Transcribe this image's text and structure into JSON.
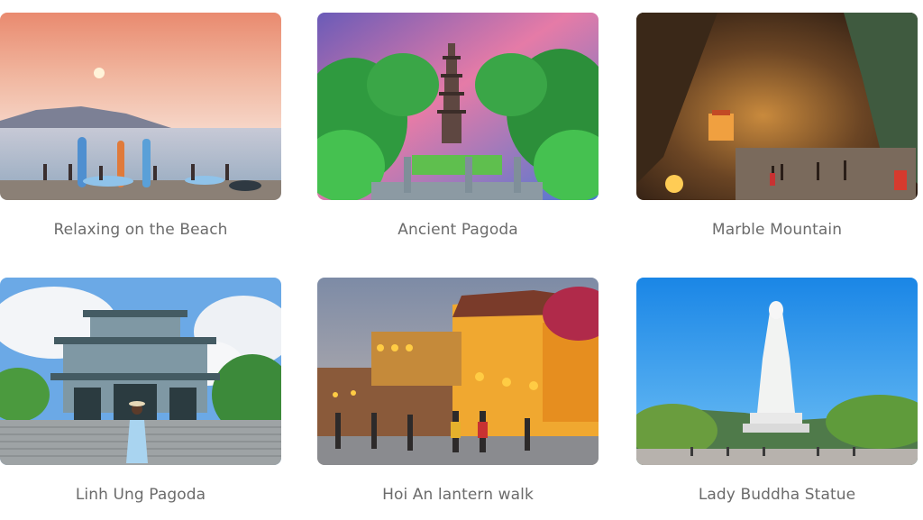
{
  "destinations": [
    {
      "title": "Relaxing on the Beach",
      "icon": "beach-photo"
    },
    {
      "title": "Ancient Pagoda",
      "icon": "pagoda-photo"
    },
    {
      "title": "Marble Mountain",
      "icon": "cave-photo"
    },
    {
      "title": "Linh Ung Pagoda",
      "icon": "temple-gate-photo"
    },
    {
      "title": "Hoi An lantern walk",
      "icon": "lantern-street-photo"
    },
    {
      "title": "Lady Buddha Statue",
      "icon": "statue-photo"
    }
  ]
}
